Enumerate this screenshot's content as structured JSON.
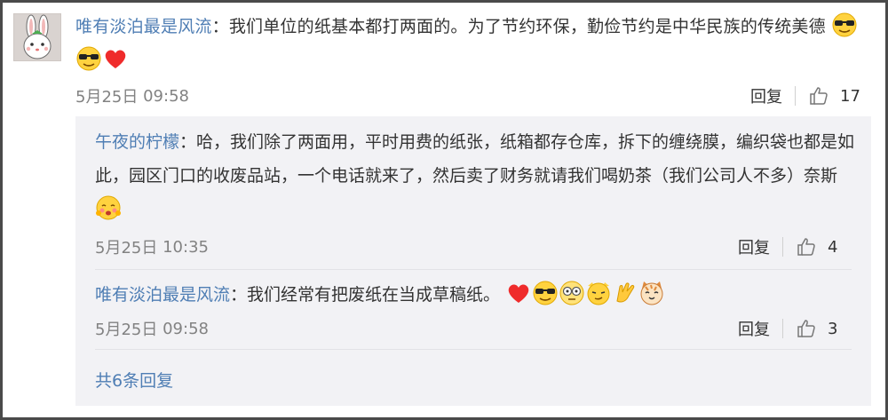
{
  "comment": {
    "author": "唯有淡泊最是风流",
    "separator": "：",
    "text": "我们单位的纸基本都打两面的。为了节约环保，勤俭节约是中华民族的传统美德",
    "emojis": [
      "sunglasses-face-icon",
      "sunglasses-face-icon",
      "red-heart-icon"
    ],
    "date": "5月25日",
    "time": "09:58",
    "reply_label": "回复",
    "likes": "17"
  },
  "replies": [
    {
      "author": "午夜的柠檬",
      "separator": "：",
      "text": "哈，我们除了两面用，平时用费的纸张，纸箱都存仓库，拆下的缠绕膜，编织袋也都是如此，园区门口的收废品站，一个电话就来了，然后卖了财务就请我们喝奶茶（我们公司人不多）奈斯",
      "emojis": [
        "blush-face-icon"
      ],
      "date": "5月25日",
      "time": "10:35",
      "reply_label": "回复",
      "likes": "4"
    },
    {
      "author": "唯有淡泊最是风流",
      "separator": "：",
      "text": "我们经常有把废纸在当成草稿纸。",
      "emojis": [
        "red-heart-icon",
        "sunglasses-face-icon",
        "dizzy-face-icon",
        "smirk-face-icon",
        "clap-hands-icon",
        "cat-face-icon"
      ],
      "date": "5月25日",
      "time": "09:58",
      "reply_label": "回复",
      "likes": "3"
    }
  ],
  "more_replies": "共6条回复",
  "colors": {
    "username_orange": "#eb7350",
    "username_blue": "#4f7eb4",
    "meta_gray": "#828282",
    "reply_bg": "#f2f2f5"
  }
}
